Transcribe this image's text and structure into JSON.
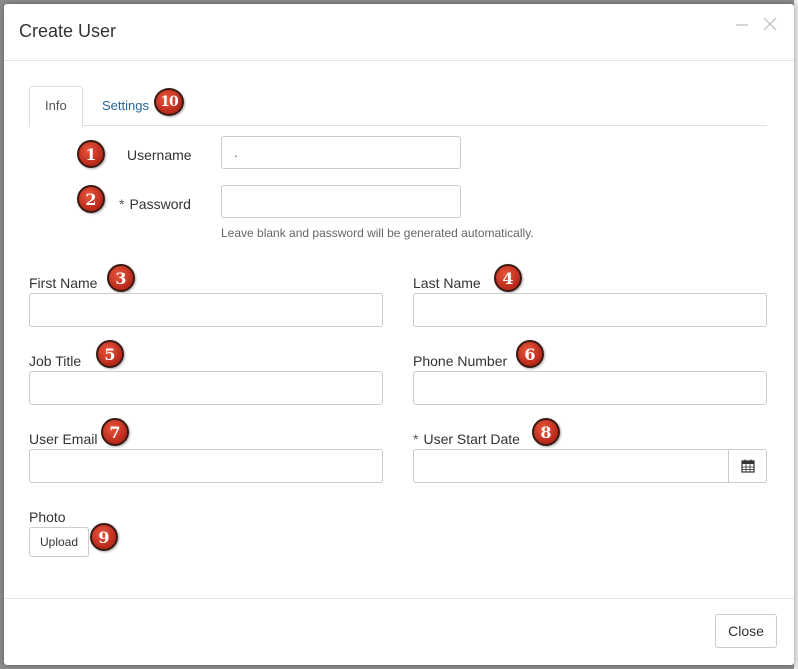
{
  "modal": {
    "title": "Create User",
    "minimize_icon": "minimize-icon",
    "close_icon": "close-icon"
  },
  "tabs": [
    {
      "label": "Info",
      "active": true
    },
    {
      "label": "Settings",
      "active": false
    }
  ],
  "form": {
    "username": {
      "label": "Username",
      "value": "."
    },
    "password": {
      "label": "Password",
      "required_mark": "*",
      "value": "",
      "help": "Leave blank and password will be generated automatically."
    },
    "first_name": {
      "label": "First Name",
      "value": ""
    },
    "last_name": {
      "label": "Last Name",
      "value": ""
    },
    "job_title": {
      "label": "Job Title",
      "value": ""
    },
    "phone_number": {
      "label": "Phone Number",
      "value": ""
    },
    "user_email": {
      "label": "User Email",
      "value": ""
    },
    "user_start_date": {
      "label": "User Start Date",
      "required_mark": "*",
      "value": "",
      "icon": "calendar-icon"
    },
    "photo": {
      "label": "Photo",
      "upload_label": "Upload"
    }
  },
  "footer": {
    "close_label": "Close"
  },
  "annotations": [
    "1",
    "2",
    "3",
    "4",
    "5",
    "6",
    "7",
    "8",
    "9",
    "10"
  ],
  "colors": {
    "link": "#2a6496",
    "badge": "#c0301f",
    "border": "#cccccc"
  }
}
